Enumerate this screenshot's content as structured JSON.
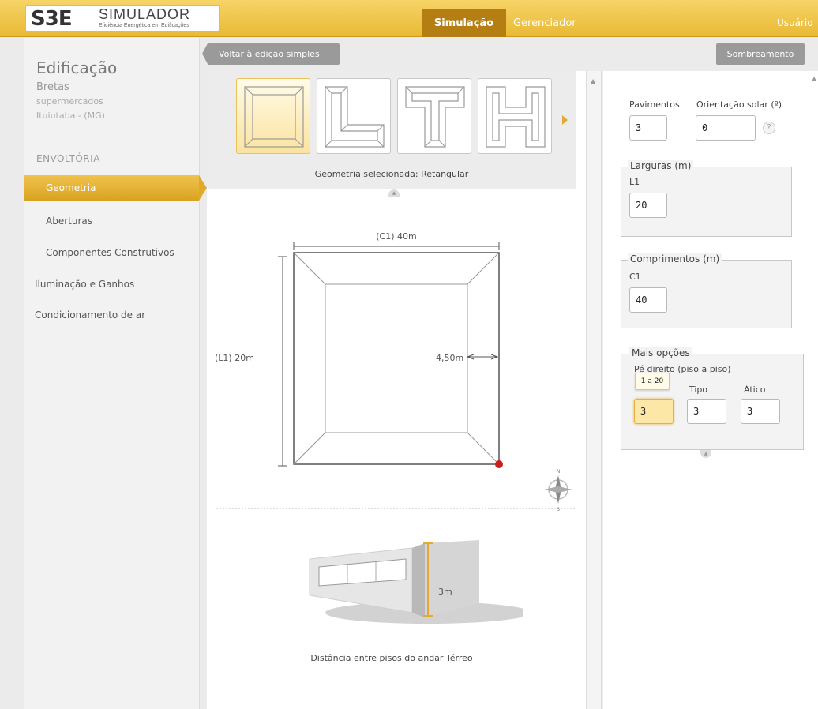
{
  "header": {
    "logo_mark": "S3E",
    "logo_title": "SIMULADOR",
    "logo_subtitle": "Eficiência Energética em Edificações",
    "nav": {
      "simulacao": "Simulação",
      "gerenciador": "Gerenciador",
      "usuario": "Usuário"
    }
  },
  "sidebar": {
    "title": "Edificação",
    "building_name": "Bretas",
    "building_type": "supermercados",
    "building_city": "Ituiutaba - (MG)",
    "section": "ENVOLTÓRIA",
    "items": {
      "geometria": "Geometria",
      "aberturas": "Aberturas",
      "componentes": "Componentes Construtivos",
      "iluminacao": "Iluminação e Ganhos",
      "condicionamento": "Condicionamento de ar"
    }
  },
  "toolbar": {
    "back_label": "Voltar à edição simples",
    "shade_label": "Sombreamento"
  },
  "geometry": {
    "caption": "Geometria selecionada: Retangular",
    "shapes": [
      "Retangular",
      "L",
      "T",
      "H"
    ],
    "selected_index": 0
  },
  "plan": {
    "c1_label": "(C1) 40m",
    "l1_label": "(L1) 20m",
    "depth_label": "4,50m",
    "compass_n": "N",
    "compass_s": "S"
  },
  "elevation": {
    "height_label": "3m",
    "caption": "Distância entre pisos do andar Térreo"
  },
  "form": {
    "pavimentos_label": "Pavimentos",
    "pavimentos_value": "3",
    "orientacao_label": "Orientação solar (º)",
    "orientacao_value": "0",
    "help_symbol": "?",
    "larguras": {
      "legend": "Larguras (m)",
      "l1_label": "L1",
      "l1_value": "20"
    },
    "comprimentos": {
      "legend": "Comprimentos (m)",
      "c1_label": "C1",
      "c1_value": "40"
    },
    "mais_opcoes": {
      "legend": "Mais opções",
      "pe_direito_legend": "Pé direito (piso a piso)",
      "tooltip": "1 a 20",
      "terreo_value": "3",
      "tipo_label": "Tipo",
      "tipo_value": "3",
      "atico_label": "Ático",
      "atico_value": "3"
    }
  },
  "colors": {
    "topbar": "#eebf3d",
    "active_nav": "#b57e13",
    "accent": "#e3a930",
    "marker_red": "#cc1f1f"
  }
}
